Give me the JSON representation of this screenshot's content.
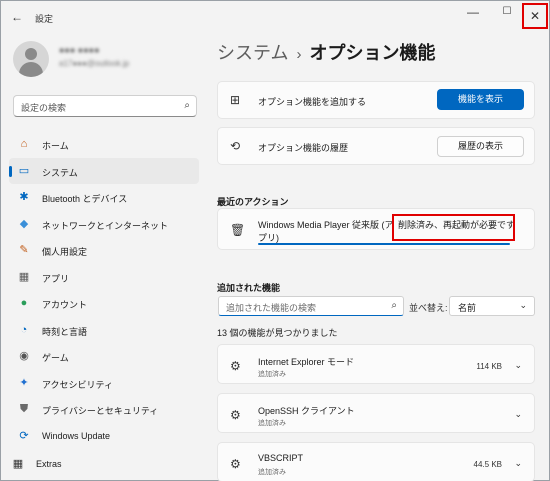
{
  "app": {
    "title": "設定",
    "back_glyph": "←"
  },
  "window_controls": {
    "minimize": "—",
    "maximize": "☐",
    "close": "✕"
  },
  "user": {
    "name": "●●● ●●●●",
    "email": "a17●●●@outlook.jp"
  },
  "search": {
    "placeholder": "設定の検索",
    "icon": "search-icon"
  },
  "nav": {
    "items": [
      {
        "label": "ホーム",
        "icon": "home-icon",
        "glyph": "⌂",
        "color": "#c05a16"
      },
      {
        "label": "システム",
        "icon": "system-icon",
        "glyph": "▭",
        "color": "#0067c0",
        "active": true
      },
      {
        "label": "Bluetooth とデバイス",
        "icon": "bluetooth-icon",
        "glyph": "✱",
        "color": "#0067c0"
      },
      {
        "label": "ネットワークとインターネット",
        "icon": "network-icon",
        "glyph": "◆",
        "color": "#3a8fd8"
      },
      {
        "label": "個人用設定",
        "icon": "personalization-icon",
        "glyph": "✎",
        "color": "#c05a16"
      },
      {
        "label": "アプリ",
        "icon": "apps-icon",
        "glyph": "▦",
        "color": "#5a5a5a"
      },
      {
        "label": "アカウント",
        "icon": "account-icon",
        "glyph": "●",
        "color": "#2a9d5a"
      },
      {
        "label": "時刻と言語",
        "icon": "time-language-icon",
        "glyph": "◔",
        "color": "#0067c0"
      },
      {
        "label": "ゲーム",
        "icon": "gaming-icon",
        "glyph": "◉",
        "color": "#555"
      },
      {
        "label": "アクセシビリティ",
        "icon": "accessibility-icon",
        "glyph": "✦",
        "color": "#1f6fd0"
      },
      {
        "label": "プライバシーとセキュリティ",
        "icon": "privacy-icon",
        "glyph": "⛊",
        "color": "#6a6a6a"
      },
      {
        "label": "Windows Update",
        "icon": "windows-update-icon",
        "glyph": "⟳",
        "color": "#0067c0"
      },
      {
        "label": "Extras",
        "icon": "extras-icon",
        "glyph": "▦",
        "color": "#333"
      }
    ]
  },
  "page": {
    "breadcrumb": "システム",
    "separator": "›",
    "title": "オプション機能"
  },
  "add_feature": {
    "label": "オプション機能を追加する",
    "button": "機能を表示",
    "icon": "add-grid-icon",
    "glyph": "⊞"
  },
  "history": {
    "label": "オプション機能の履歴",
    "button": "履歴の表示",
    "icon": "history-icon",
    "glyph": "⟲"
  },
  "recent": {
    "heading": "最近のアクション",
    "item_text": "Windows Media Player 従来版 (アンインストール - 削除済み、再起動が必要です)",
    "line1": "Windows Media Player 従来版 (ア",
    "highlight_line1": "削除済み、再起動が必要です",
    "line2": "プリ)",
    "icon": "trash-icon",
    "glyph": "🗑"
  },
  "added": {
    "heading": "追加された機能",
    "search_placeholder": "追加された機能の検索",
    "sort_label": "並べ替え:",
    "sort_value": "名前",
    "count_text": "13 個の機能が見つかりました",
    "features": [
      {
        "name": "Internet Explorer モード",
        "status": "追加済み",
        "size": "114 KB"
      },
      {
        "name": "OpenSSH クライアント",
        "status": "追加済み",
        "size": ""
      },
      {
        "name": "VBSCRIPT",
        "status": "追加済み",
        "size": "44.5 KB"
      }
    ]
  }
}
